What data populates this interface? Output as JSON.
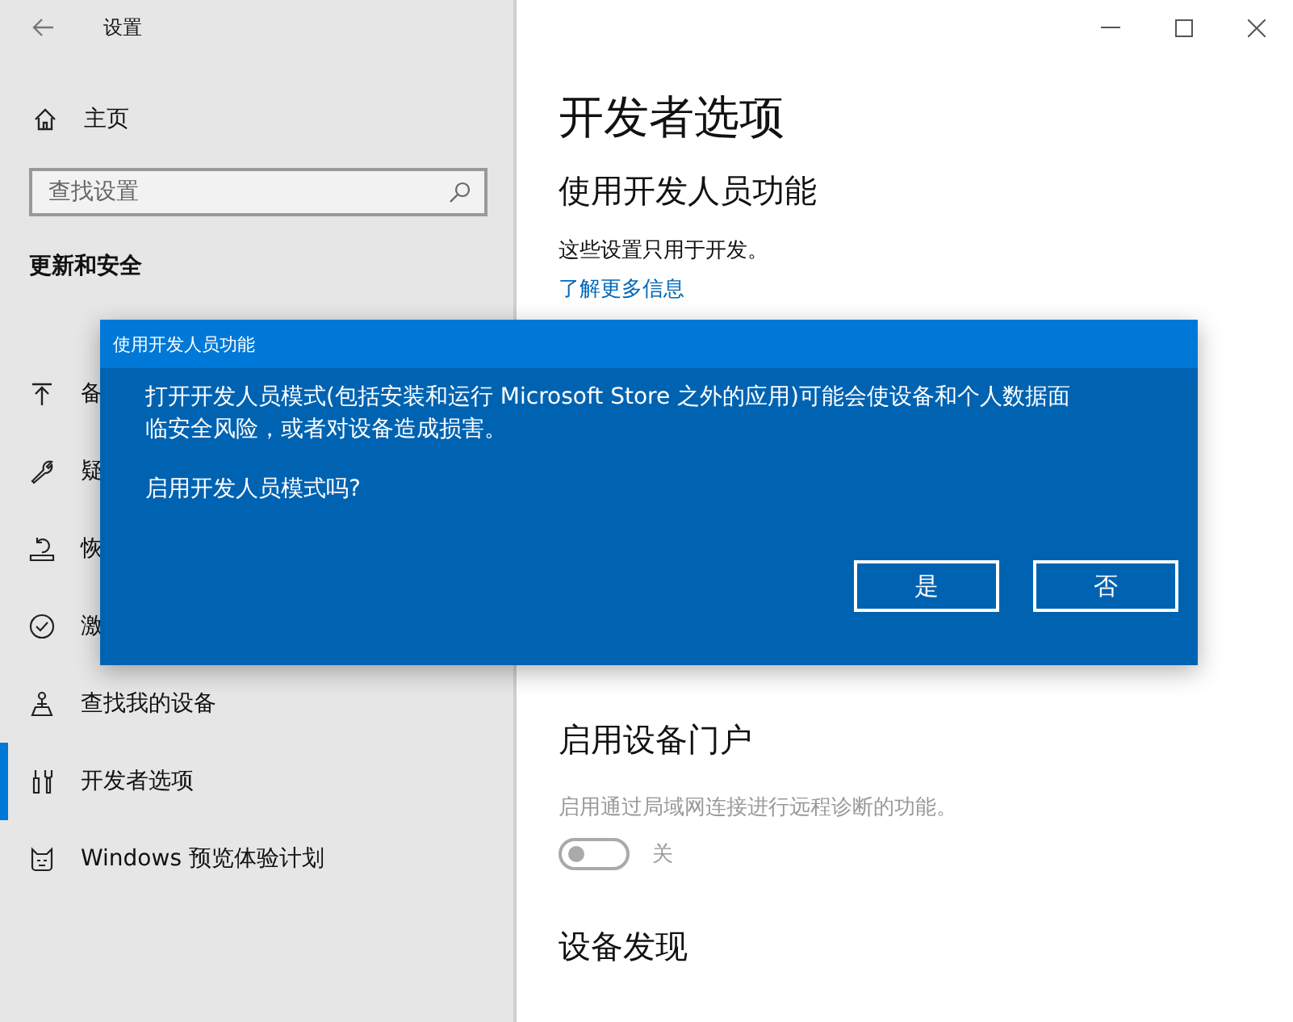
{
  "window": {
    "title": "设置"
  },
  "sidebar": {
    "home": "主页",
    "search": {
      "placeholder": "查找设置"
    },
    "section": "更新和安全",
    "items": [
      {
        "label": "备",
        "kind": "upload",
        "selected": false
      },
      {
        "label": "疑",
        "kind": "wrench",
        "selected": false
      },
      {
        "label": "恢",
        "kind": "restore",
        "selected": false
      },
      {
        "label": "激",
        "kind": "check",
        "selected": false
      },
      {
        "label": "查找我的设备",
        "kind": "person",
        "selected": false
      },
      {
        "label": "开发者选项",
        "kind": "tools",
        "selected": true
      },
      {
        "label": "Windows 预览体验计划",
        "kind": "cat",
        "selected": false
      }
    ]
  },
  "page": {
    "title": "开发者选项",
    "section": "使用开发人员功能",
    "note": "这些设置只用于开发。",
    "link": "了解更多信息",
    "portal": {
      "title": "启用设备门户",
      "description": "启用通过局域网连接进行远程诊断的功能。",
      "toggle": {
        "on": false,
        "disabled": true,
        "label": "关"
      }
    },
    "discovery": {
      "title": "设备发现"
    }
  },
  "dialog": {
    "title": "使用开发人员功能",
    "message": "打开开发人员模式(包括安装和运行 Microsoft Store 之外的应用)可能会使设备和个人数据面临安全风险，或者对设备造成损害。",
    "question": "启用开发人员模式吗?",
    "buttons": [
      "是",
      "否"
    ]
  }
}
